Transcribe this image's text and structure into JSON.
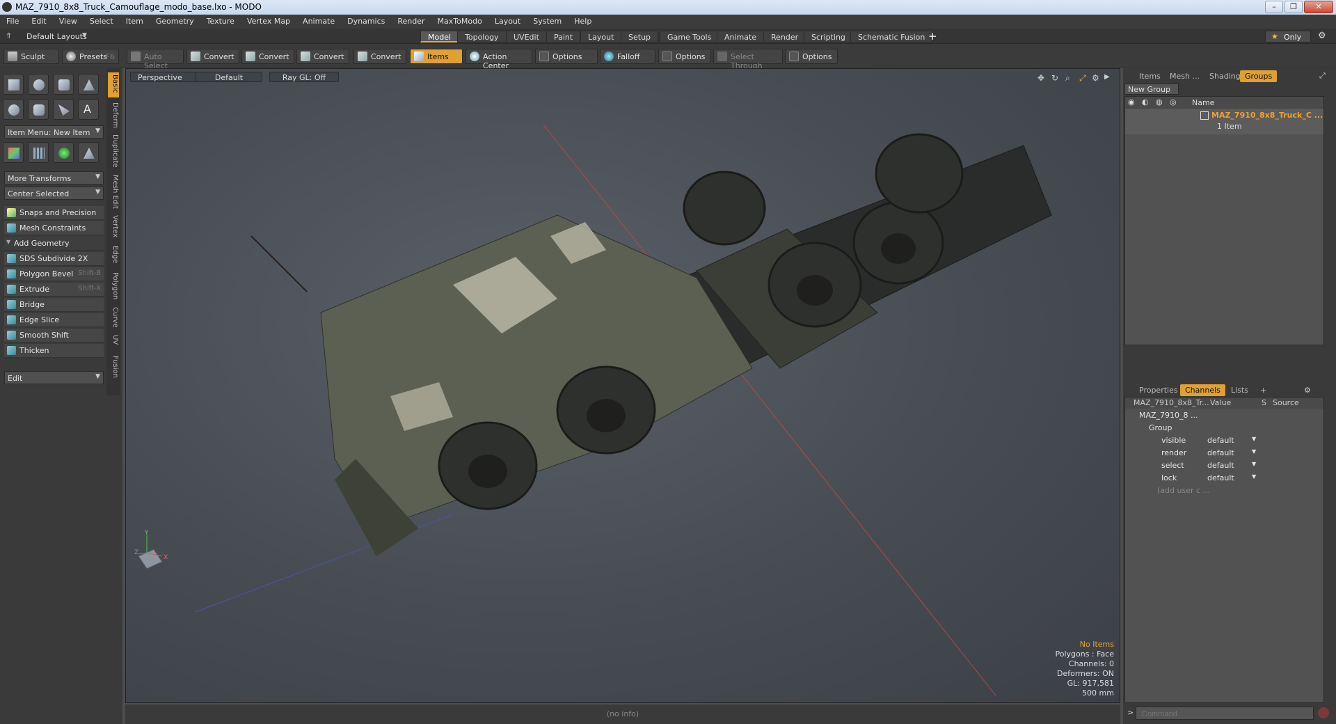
{
  "window": {
    "title": "MAZ_7910_8x8_Truck_Camouflage_modo_base.lxo - MODO",
    "controls": [
      "–",
      "❐",
      "✕"
    ]
  },
  "menu": [
    "File",
    "Edit",
    "View",
    "Select",
    "Item",
    "Geometry",
    "Texture",
    "Vertex Map",
    "Animate",
    "Dynamics",
    "Render",
    "MaxToModo",
    "Layout",
    "System",
    "Help"
  ],
  "layout": {
    "preset": "Default Layouts",
    "tabs": [
      "Model",
      "Topology",
      "UVEdit",
      "Paint",
      "Layout",
      "Setup",
      "Game Tools",
      "Animate",
      "Render",
      "Scripting",
      "Schematic Fusion"
    ],
    "active_tab": "Model",
    "add": "+",
    "only": "Only"
  },
  "toolbar": {
    "sculpt": "Sculpt",
    "presets": "Presets",
    "presets_key": "F6",
    "auto_select": "Auto Select",
    "convert1": "Convert",
    "convert2": "Convert",
    "convert3": "Convert",
    "convert4": "Convert",
    "items": "Items",
    "action_center": "Action Center",
    "options1": "Options",
    "falloff": "Falloff",
    "options2": "Options",
    "select_through": "Select Through",
    "options3": "Options"
  },
  "left": {
    "item_menu": "Item Menu: New Item",
    "more_transforms": "More Transforms",
    "center_selected": "Center Selected",
    "snaps": "Snaps and Precision",
    "mesh_constraints": "Mesh Constraints",
    "add_geometry": "Add Geometry",
    "tools": [
      {
        "label": "SDS Subdivide 2X",
        "key": ""
      },
      {
        "label": "Polygon Bevel",
        "key": "Shift-B"
      },
      {
        "label": "Extrude",
        "key": "Shift-X"
      },
      {
        "label": "Bridge",
        "key": ""
      },
      {
        "label": "Edge Slice",
        "key": ""
      },
      {
        "label": "Smooth Shift",
        "key": ""
      },
      {
        "label": "Thicken",
        "key": ""
      }
    ],
    "edit": "Edit",
    "vtabs": [
      "Basic",
      "Deform",
      "Duplicate",
      "Mesh Edit",
      "Vertex",
      "Edge",
      "Polygon",
      "Curve",
      "UV",
      "Fusion"
    ]
  },
  "viewport": {
    "view": "Perspective",
    "shading": "Default",
    "raygl": "Ray GL: Off",
    "info": [
      "No Items",
      "Polygons : Face",
      "Channels: 0",
      "Deformers: ON",
      "GL: 917,581",
      "500 mm"
    ],
    "axis_labels": [
      "Y",
      "Z",
      "X"
    ]
  },
  "status": "(no info)",
  "groups_panel": {
    "tabs": [
      "Items",
      "Mesh ...",
      "Shading",
      "Groups"
    ],
    "active": "Groups",
    "new_group": "New Group",
    "col_name": "Name",
    "item_name": "MAZ_7910_8x8_Truck_C ...",
    "item_count": "1 Item"
  },
  "channels_panel": {
    "tabs": [
      "Properties",
      "Channels",
      "Lists",
      "+"
    ],
    "active": "Channels",
    "columns": [
      "MAZ_7910_8x8_Tr...",
      "Value",
      "S",
      "Source"
    ],
    "root": "MAZ_7910_8 ...",
    "group": "Group",
    "rows": [
      {
        "name": "visible",
        "value": "default"
      },
      {
        "name": "render",
        "value": "default"
      },
      {
        "name": "select",
        "value": "default"
      },
      {
        "name": "lock",
        "value": "default"
      }
    ],
    "add_user": "(add user c ..."
  },
  "command": {
    "prompt": ">",
    "placeholder": "Command"
  },
  "colors": {
    "accent": "#e0a032",
    "title_orange": "#f0a030"
  }
}
